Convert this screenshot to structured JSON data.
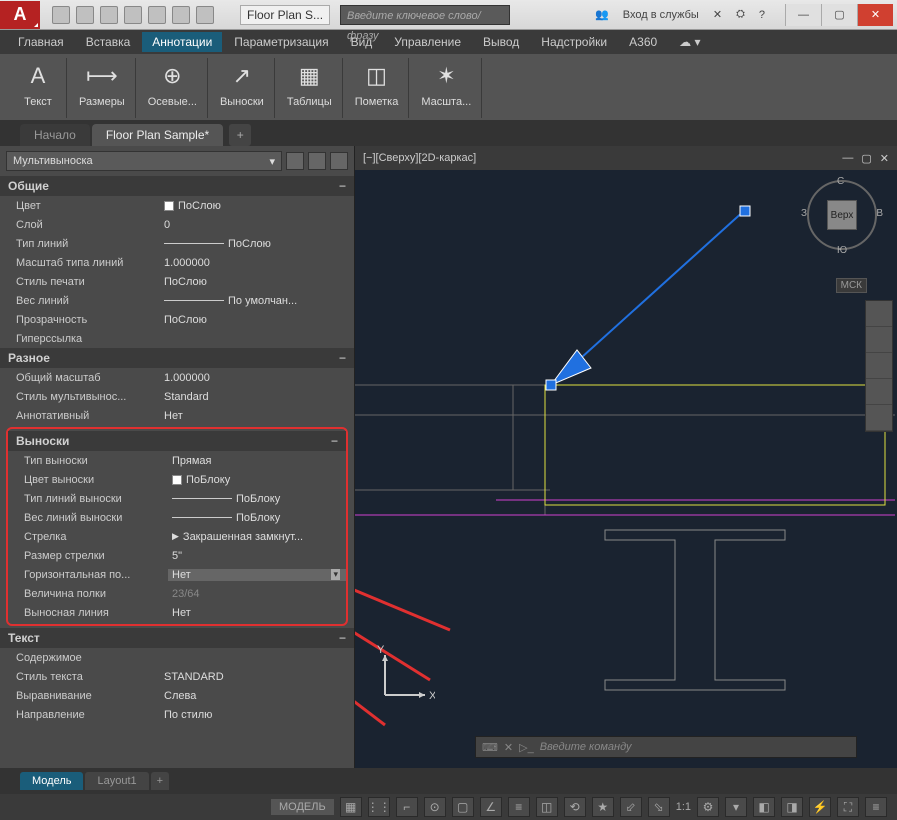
{
  "app": {
    "logo": "A",
    "title": "Floor Plan S...",
    "search_ph": "Введите ключевое слово/фразу",
    "signin": "Вход в службы"
  },
  "menu": [
    "Главная",
    "Вставка",
    "Аннотации",
    "Параметризация",
    "Вид",
    "Управление",
    "Вывод",
    "Надстройки",
    "A360"
  ],
  "menu_active": 2,
  "ribbon": [
    {
      "icon": "A",
      "label": "Текст"
    },
    {
      "icon": "⟼",
      "label": "Размеры"
    },
    {
      "icon": "⊕",
      "label": "Осевые..."
    },
    {
      "icon": "↗",
      "label": "Выноски"
    },
    {
      "icon": "▦",
      "label": "Таблицы"
    },
    {
      "icon": "◫",
      "label": "Пометка"
    },
    {
      "icon": "✶",
      "label": "Масшта..."
    }
  ],
  "doctabs": {
    "start": "Начало",
    "active": "Floor Plan Sample*"
  },
  "viewport_title": "[−][Сверху][2D-каркас]",
  "viewcube": {
    "top": "С",
    "right": "В",
    "bottom": "Ю",
    "left": "З",
    "face": "Верх",
    "wcs": "МСК"
  },
  "props": {
    "type": "Мультивыноска",
    "sections": {
      "general": {
        "title": "Общие",
        "rows": [
          {
            "l": "Цвет",
            "v": "ПоСлою",
            "swatch": true
          },
          {
            "l": "Слой",
            "v": "0"
          },
          {
            "l": "Тип линий",
            "v": "ПоСлою",
            "line": true
          },
          {
            "l": "Масштаб типа линий",
            "v": "1.000000"
          },
          {
            "l": "Стиль печати",
            "v": "ПоСлою"
          },
          {
            "l": "Вес линий",
            "v": "По умолчан...",
            "line": true
          },
          {
            "l": "Прозрачность",
            "v": "ПоСлою"
          },
          {
            "l": "Гиперссылка",
            "v": ""
          }
        ]
      },
      "misc": {
        "title": "Разное",
        "rows": [
          {
            "l": "Общий масштаб",
            "v": "1.000000"
          },
          {
            "l": "Стиль мультивынос...",
            "v": "Standard"
          },
          {
            "l": "Аннотативный",
            "v": "Нет"
          }
        ]
      },
      "leaders": {
        "title": "Выноски",
        "rows": [
          {
            "l": "Тип выноски",
            "v": "Прямая"
          },
          {
            "l": "Цвет выноски",
            "v": "ПоБлоку",
            "swatch": true
          },
          {
            "l": "Тип линий выноски",
            "v": "ПоБлоку",
            "line": true
          },
          {
            "l": "Вес линий выноски",
            "v": "ПоБлоку",
            "line": true
          },
          {
            "l": "Стрелка",
            "v": "Закрашенная замкнут...",
            "arrow": true
          },
          {
            "l": "Размер стрелки",
            "v": "5\""
          },
          {
            "l": "Горизонтальная по...",
            "v": "Нет",
            "dropdown": true
          },
          {
            "l": "Величина полки",
            "v": "23/64",
            "disabled": true
          },
          {
            "l": "Выносная линия",
            "v": "Нет"
          }
        ]
      },
      "text": {
        "title": "Текст",
        "rows": [
          {
            "l": "Содержимое",
            "v": ""
          },
          {
            "l": "Стиль текста",
            "v": "STANDARD"
          },
          {
            "l": "Выравнивание",
            "v": "Слева"
          },
          {
            "l": "Направление",
            "v": "По стилю"
          }
        ]
      }
    }
  },
  "cmd_ph": "Введите команду",
  "bottomtabs": {
    "model": "Модель",
    "layout": "Layout1"
  },
  "status": {
    "model": "МОДЕЛЬ",
    "scale": "1:1"
  },
  "ucs": {
    "x": "X",
    "y": "Y"
  }
}
